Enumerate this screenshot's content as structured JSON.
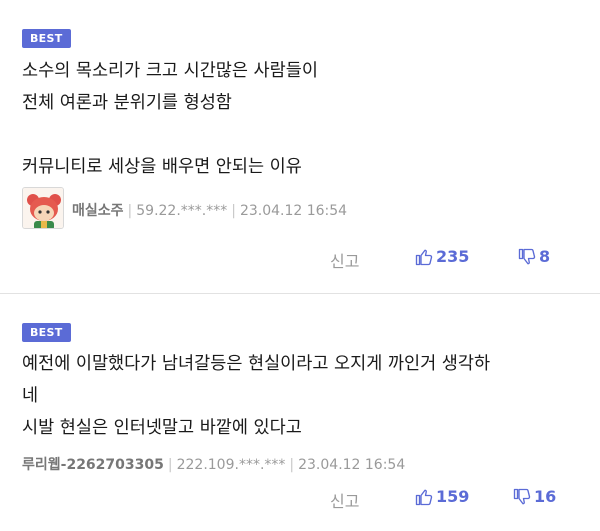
{
  "comments": [
    {
      "badge": "BEST",
      "lines": [
        "소수의 목소리가 크고 시간많은 사람들이",
        "전체 여론과 분위기를 형성함",
        "",
        "커뮤니티로 세상을 배우면 안되는 이유"
      ],
      "author": "매실소주",
      "ip": "59.22.***.***",
      "date": "23.04.12 16:54",
      "report_label": "신고",
      "likes": "235",
      "dislikes": "8"
    },
    {
      "badge": "BEST",
      "lines": [
        "예전에 이말했다가 남녀갈등은 현실이라고 오지게 까인거 생각하",
        "네",
        "시발 현실은 인터넷말고 바깥에 있다고"
      ],
      "author": "루리웹-2262703305",
      "ip": "222.109.***.***",
      "date": "23.04.12 16:54",
      "report_label": "신고",
      "likes": "159",
      "dislikes": "16"
    }
  ],
  "icons": {
    "thumbs_up": "thumbs-up-icon",
    "thumbs_down": "thumbs-down-icon",
    "avatar": "character-avatar"
  },
  "colors": {
    "accent": "#5b6bd6",
    "muted": "#9a9a9a"
  }
}
